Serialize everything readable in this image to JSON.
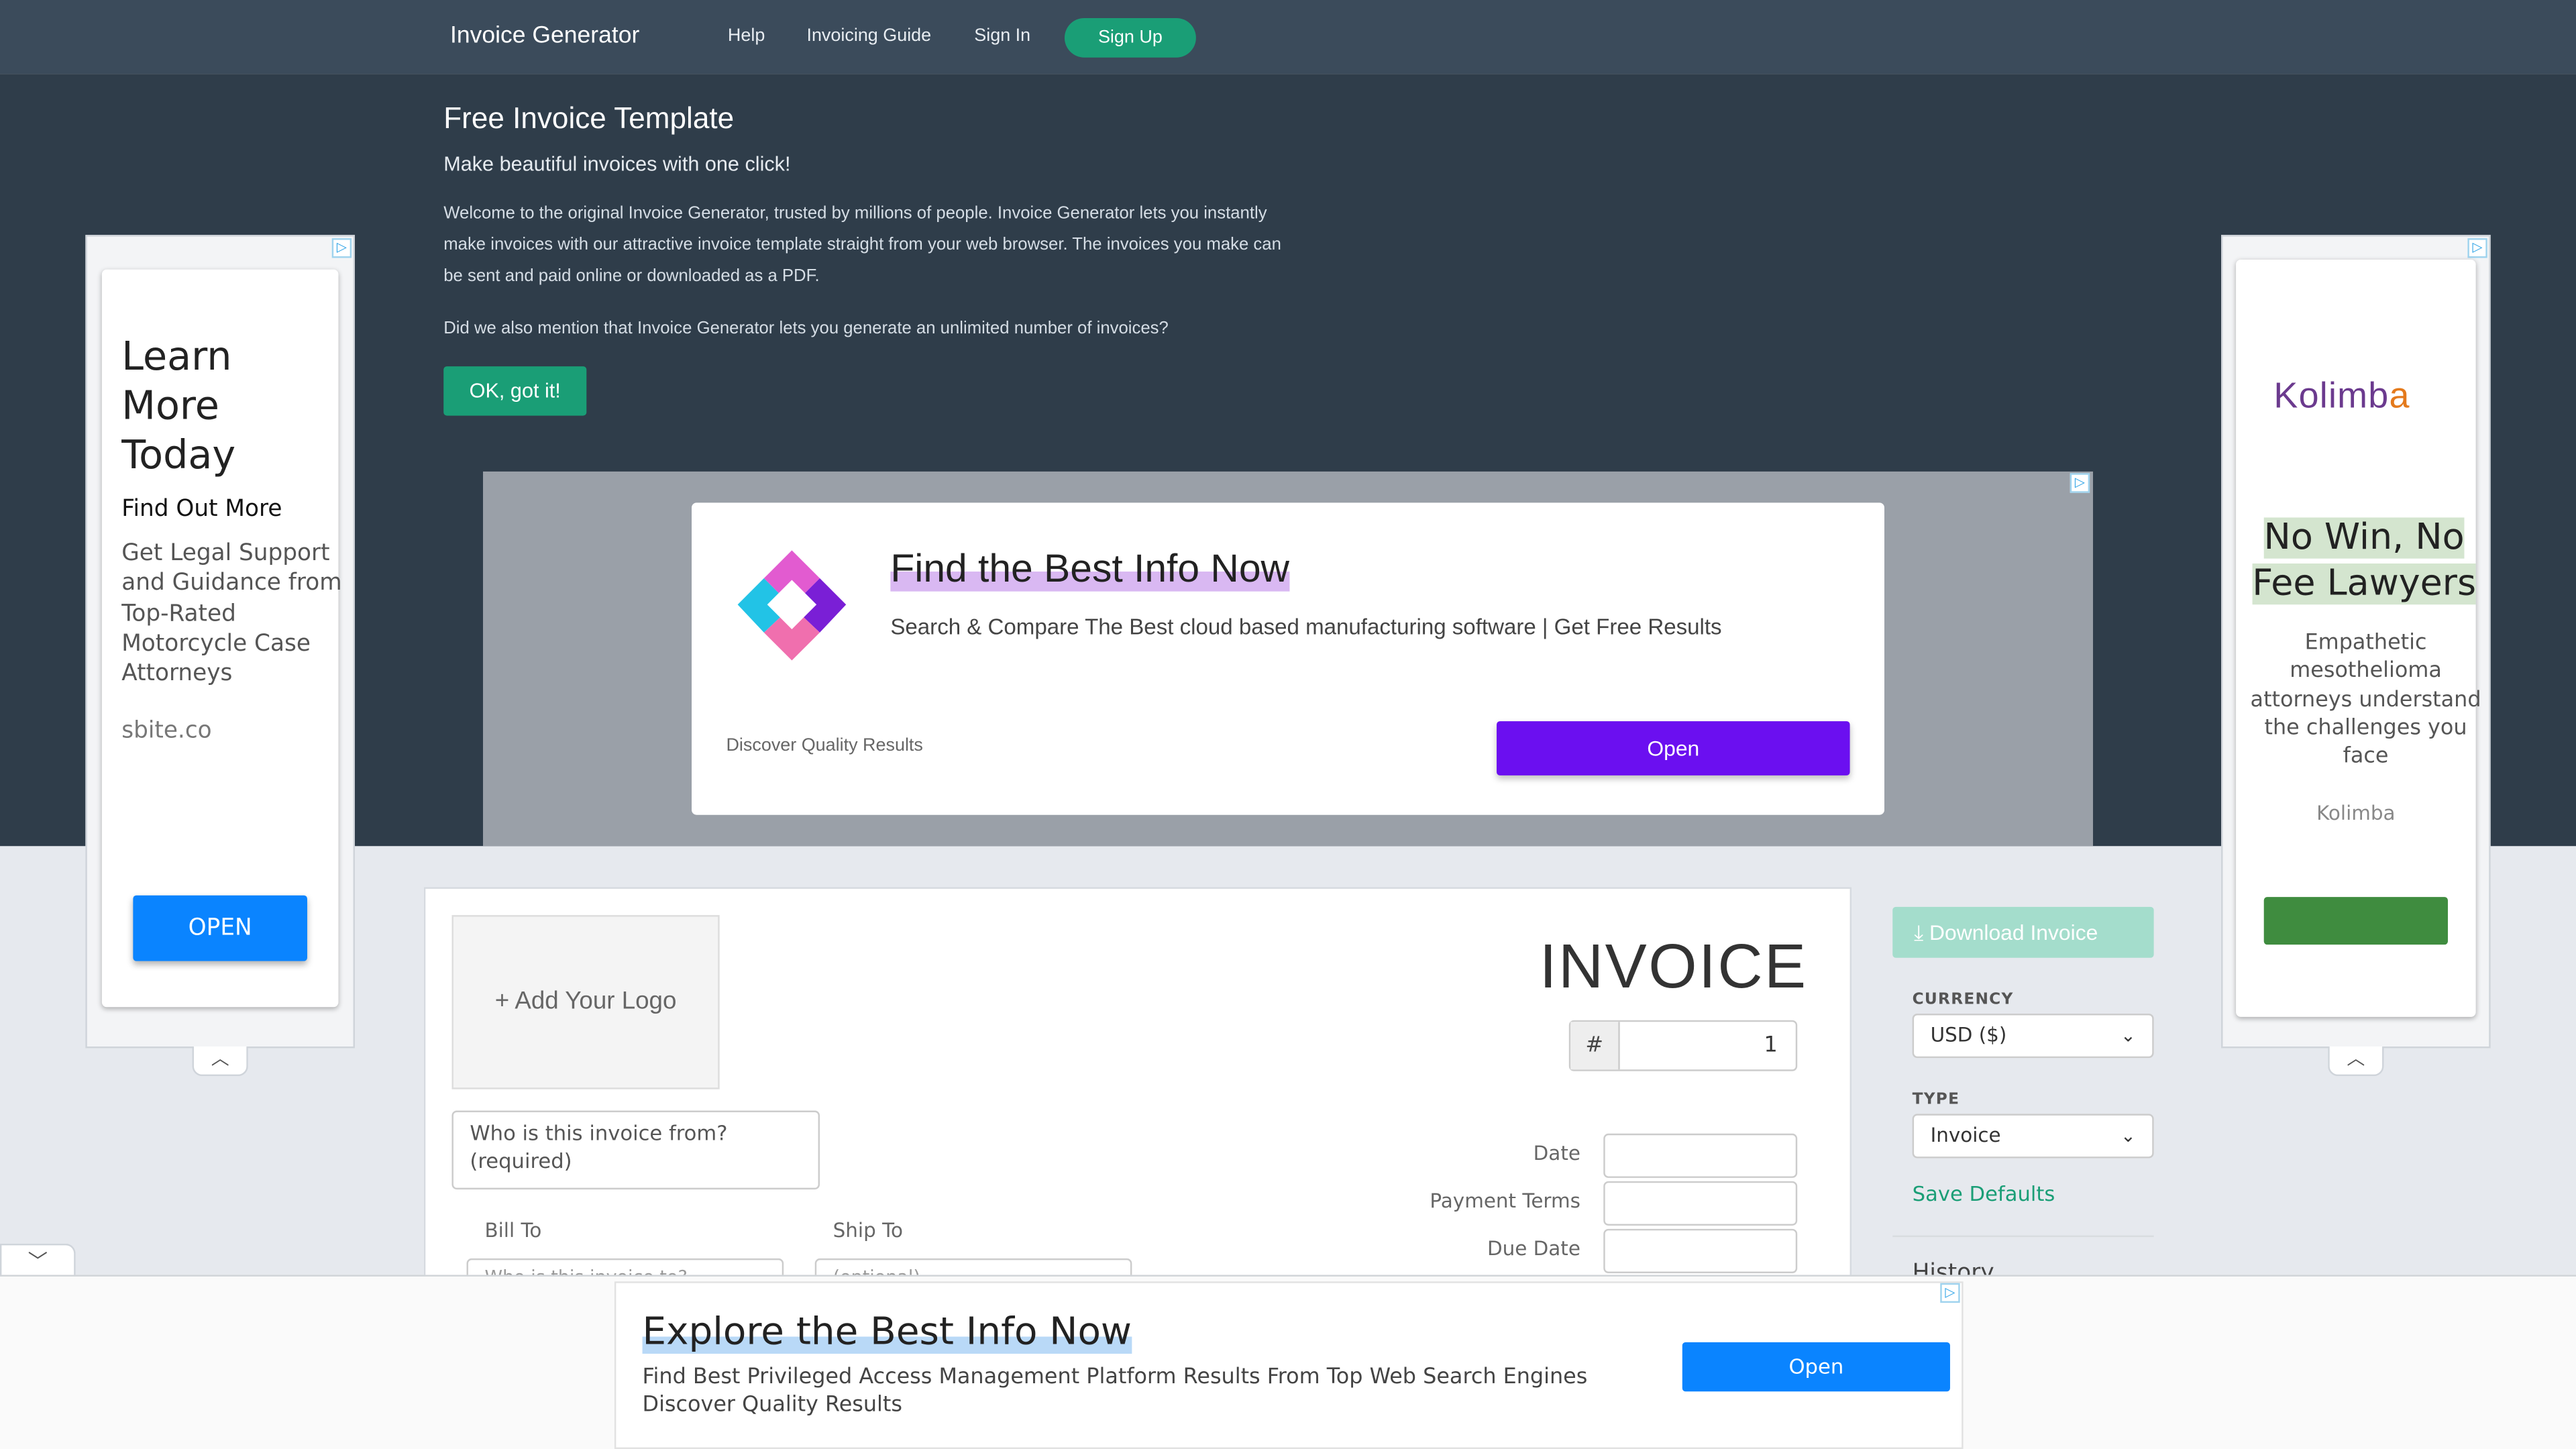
{
  "nav": {
    "brand": "Invoice Generator",
    "links": [
      "Help",
      "Invoicing Guide",
      "Sign In"
    ],
    "signup": "Sign Up"
  },
  "hero": {
    "title": "Free Invoice Template",
    "subtitle": "Make beautiful invoices with one click!",
    "paragraph1": "Welcome to the original Invoice Generator, trusted by millions of people. Invoice Generator lets you instantly make invoices with our attractive invoice template straight from your web browser. The invoices you make can be sent and paid online or downloaded as a PDF.",
    "paragraph2": "Did we also mention that Invoice Generator lets you generate an unlimited number of invoices?",
    "ok_button": "OK, got it!"
  },
  "left_ad": {
    "headline": "Learn More Today",
    "find": "Find Out More",
    "description": "Get Legal Support and Guidance from Top-Rated Motorcycle Case Attorneys",
    "url": "sbite.co",
    "button": "OPEN"
  },
  "right_ad": {
    "logo_text": "Kolimb",
    "logo_accent": "a",
    "headline": "No Win, No Fee Lawyers",
    "description": "Empathetic mesothelioma attorneys understand the challenges you face",
    "brand": "Kolimba"
  },
  "center_ad": {
    "headline": "Find the Best Info Now",
    "description": "Search & Compare The Best cloud based manufacturing software | Get Free Results",
    "disclaimer": "Discover Quality Results",
    "button": "Open"
  },
  "invoice": {
    "add_logo": "+ Add Your Logo",
    "title": "INVOICE",
    "number_prefix": "#",
    "number": "1",
    "from_placeholder": "Who is this invoice from? (required)",
    "bill_to_label": "Bill To",
    "ship_to_label": "Ship To",
    "bill_to_placeholder": "Who is this invoice to? (required)",
    "ship_to_placeholder": "(optional)",
    "date_label": "Date",
    "payment_terms_label": "Payment Terms",
    "due_date_label": "Due Date"
  },
  "sidebar": {
    "download": "Download Invoice",
    "currency_label": "CURRENCY",
    "currency_value": "USD ($)",
    "type_label": "TYPE",
    "type_value": "Invoice",
    "save_defaults": "Save Defaults",
    "history": "History"
  },
  "bottom_ad": {
    "headline": "Explore the Best Info Now",
    "description": "Find Best Privileged Access Management Platform Results From Top Web Search Engines Discover Quality Results",
    "button": "Open"
  },
  "colors": {
    "nav_bg": "#3b4b5b",
    "hero_bg": "#2f3d4a",
    "accent_green": "#1a9e76",
    "ad_blue": "#0a84ff",
    "ad_purple": "#6b0ff0"
  },
  "icons": [
    "ad-choices-icon",
    "chevron-up-icon",
    "chevron-down-icon",
    "download-icon",
    "center-ad-logo-icon"
  ]
}
